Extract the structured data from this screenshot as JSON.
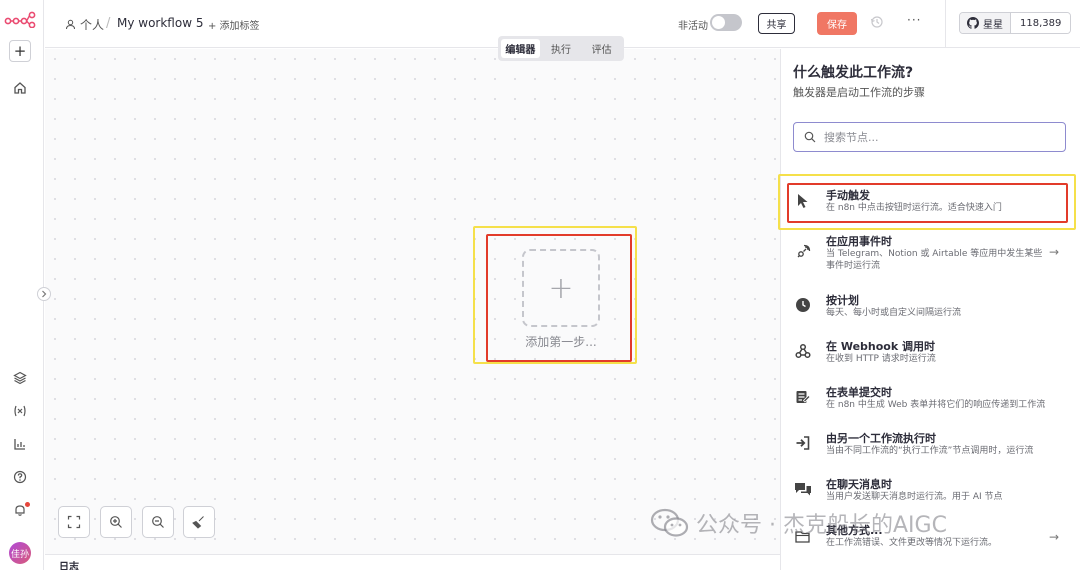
{
  "header": {
    "owner": "个人",
    "separator": "/",
    "workflow_name": "My workflow 5",
    "add_tag": "+ 添加标签",
    "inactive_label": "非活动",
    "share_label": "共享",
    "save_label": "保存",
    "more_label": "···",
    "github_label": "星星",
    "github_count": "118,389"
  },
  "tabs": [
    {
      "label": "编辑器",
      "active": true
    },
    {
      "label": "执行",
      "active": false
    },
    {
      "label": "评估",
      "active": false
    }
  ],
  "canvas": {
    "add_first_step": "添加第一步...",
    "plus": "+"
  },
  "log": {
    "label": "日志"
  },
  "sidebar": {
    "add": "+",
    "avatar": "佳孙"
  },
  "panel": {
    "title": "什么触发此工作流?",
    "subtitle": "触发器是启动工作流的步骤",
    "search_placeholder": "搜索节点...",
    "triggers": [
      {
        "icon": "cursor-icon",
        "title": "手动触发",
        "desc": "在 n8n 中点击按钮时运行流。适合快速入门",
        "arrow": ""
      },
      {
        "icon": "app-event-icon",
        "title": "在应用事件时",
        "desc": "当 Telegram、Notion 或 Airtable 等应用中发生某些事件时运行流",
        "arrow": "→"
      },
      {
        "icon": "clock-icon",
        "title": "按计划",
        "desc": "每天、每小时或自定义间隔运行流",
        "arrow": ""
      },
      {
        "icon": "webhook-icon",
        "title": "在 Webhook 调用时",
        "desc": "在收到 HTTP 请求时运行流",
        "arrow": ""
      },
      {
        "icon": "form-icon",
        "title": "在表单提交时",
        "desc": "在 n8n 中生成 Web 表单并将它们的响应传递到工作流",
        "arrow": ""
      },
      {
        "icon": "sign-in-icon",
        "title": "由另一个工作流执行时",
        "desc": "当由不同工作流的“执行工作流”节点调用时，运行流",
        "arrow": ""
      },
      {
        "icon": "chat-icon",
        "title": "在聊天消息时",
        "desc": "当用户发送聊天消息时运行流。用于 AI 节点",
        "arrow": ""
      },
      {
        "icon": "folder-icon",
        "title": "其他方式...",
        "desc": "在工作流错误、文件更改等情况下运行流。",
        "arrow": "→"
      }
    ]
  },
  "watermark": {
    "text": "公众号 · 杰克船长的AIGC"
  },
  "colors": {
    "accent": "#f07764",
    "highlight_red": "#e23b2a",
    "highlight_yellow": "#f5e04a",
    "brand": "#ea4b71"
  }
}
